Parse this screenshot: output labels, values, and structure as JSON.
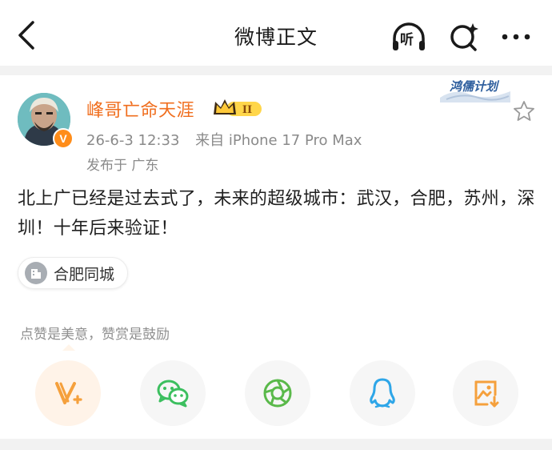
{
  "header": {
    "title": "微博正文",
    "listen_label": "听"
  },
  "post": {
    "username": "峰哥亡命天涯",
    "member_level": "II",
    "verified_mark": "V",
    "date": "26-6-3 12:33",
    "source": "来自 iPhone 17 Pro Max",
    "location": "发布于 广东",
    "hongru_badge": "鸿儒计划",
    "content": "北上广已经是过去式了，未来的超级城市：武汉，合肥，苏州，深圳！十年后来验证！",
    "topic_label": "合肥同城"
  },
  "reward": {
    "text": "点赞是美意，赞赏是鼓励"
  },
  "share_buttons": [
    {
      "icon": "v-plus-icon",
      "color": "#f5a03c"
    },
    {
      "icon": "wechat-icon",
      "color": "#3cbf5f"
    },
    {
      "icon": "moments-icon",
      "color": "#5ab94a"
    },
    {
      "icon": "qq-icon",
      "color": "#2ea6e8"
    },
    {
      "icon": "save-image-icon",
      "color": "#f5a03c"
    }
  ],
  "colors": {
    "username": "#f06e1e",
    "meta": "#8a8a8a",
    "accent": "#ff8d1a"
  }
}
